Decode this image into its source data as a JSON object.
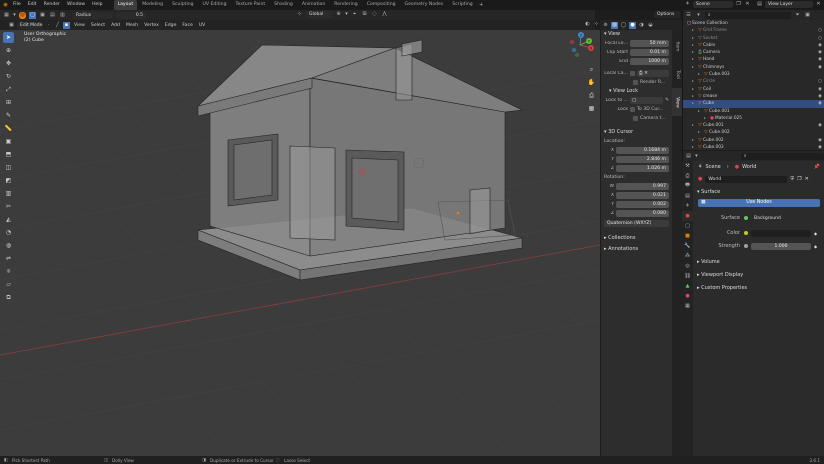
{
  "topbar": {
    "menus": [
      "File",
      "Edit",
      "Render",
      "Window",
      "Help"
    ],
    "workspaces": [
      "Layout",
      "Modeling",
      "Sculpting",
      "UV Editing",
      "Texture Paint",
      "Shading",
      "Animation",
      "Rendering",
      "Compositing",
      "Geometry Nodes",
      "Scripting"
    ],
    "active_workspace": "Layout",
    "radius_label": "Radius",
    "radius_value": "0.5",
    "scene_label": "Scene",
    "view_layer_label": "View Layer"
  },
  "viewport_header": {
    "mode": "Edit Mode",
    "menus": [
      "View",
      "Select",
      "Add",
      "Mesh",
      "Vertex",
      "Edge",
      "Face",
      "UV"
    ],
    "orientation": "Global",
    "options_label": "Options"
  },
  "viewport": {
    "view_name": "User Orthographic",
    "object_name": "(2) Cube"
  },
  "gizmo": {
    "x": "X",
    "y": "Y",
    "z": "Z"
  },
  "npanel": {
    "tabs": [
      "Item",
      "Tool",
      "View"
    ],
    "active_tab": "View",
    "view": {
      "title": "View",
      "focal_label": "Focal Le...",
      "focal_value": "50 mm",
      "clip_start_label": "Clip Start",
      "clip_start_value": "0.01 m",
      "end_label": "End",
      "end_value": "1000 m",
      "local_camera_label": "Local Ca...",
      "render_region_label": "Render R..."
    },
    "view_lock": {
      "title": "View Lock",
      "lock_to_label": "Lock to ...",
      "lock_label": "Lock",
      "to_3d_cursor": "To 3D Cur...",
      "camera_to": "Camera t..."
    },
    "cursor": {
      "title": "3D Cursor",
      "location_label": "Location:",
      "loc_x_label": "X",
      "loc_x": "0.1684 m",
      "loc_y_label": "Y",
      "loc_y": "2.846 m",
      "loc_z_label": "Z",
      "loc_z": "1.026 m",
      "rotation_label": "Rotation:",
      "rot_w_label": "W",
      "rot_w": "0.997",
      "rot_x_label": "X",
      "rot_x": "0.021",
      "rot_y_label": "Y",
      "rot_y": "0.002",
      "rot_z_label": "Z",
      "rot_z": "0.080",
      "rotation_mode": "Quaternion (WXYZ)"
    },
    "collections_title": "Collections",
    "annotations_title": "Annotations"
  },
  "outliner": {
    "root": "Scene Collection",
    "items": [
      {
        "name": "Grid Frame",
        "icon": "mesh",
        "indent": 1,
        "dim": true,
        "vis": "○"
      },
      {
        "name": "Socket",
        "icon": "mesh",
        "indent": 1,
        "dim": true,
        "vis": "○"
      },
      {
        "name": "Cabin",
        "icon": "mesh",
        "indent": 1,
        "dim": false,
        "vis": "◉"
      },
      {
        "name": "Camera",
        "icon": "camera",
        "indent": 1,
        "dim": false,
        "vis": "◉"
      },
      {
        "name": "Hand",
        "icon": "mesh",
        "indent": 1,
        "dim": false,
        "vis": "◉"
      },
      {
        "name": "Chimneys",
        "icon": "mesh",
        "indent": 1,
        "dim": false,
        "vis": "◉"
      },
      {
        "name": "Cube.003",
        "icon": "mesh",
        "indent": 2,
        "dim": false,
        "vis": ""
      },
      {
        "name": "Circle",
        "icon": "mesh",
        "indent": 1,
        "dim": true,
        "vis": "○"
      },
      {
        "name": "Coil",
        "icon": "mesh",
        "indent": 1,
        "dim": false,
        "vis": "◉"
      },
      {
        "name": "crease",
        "icon": "mesh",
        "indent": 1,
        "dim": false,
        "vis": "◉"
      },
      {
        "name": "Cube",
        "icon": "mesh",
        "indent": 1,
        "dim": false,
        "vis": "◉",
        "selected": true
      },
      {
        "name": "Cube.001",
        "icon": "mesh",
        "indent": 2,
        "dim": false,
        "vis": ""
      },
      {
        "name": "Material.025",
        "icon": "material",
        "indent": 3,
        "dim": false,
        "vis": ""
      },
      {
        "name": "Cube.001",
        "icon": "mesh",
        "indent": 1,
        "dim": false,
        "vis": "◉"
      },
      {
        "name": "Cube.002",
        "icon": "mesh",
        "indent": 2,
        "dim": false,
        "vis": ""
      },
      {
        "name": "Cube.002",
        "icon": "mesh",
        "indent": 1,
        "dim": false,
        "vis": "◉"
      },
      {
        "name": "Cube.003",
        "icon": "mesh",
        "indent": 1,
        "dim": false,
        "vis": "◉"
      }
    ]
  },
  "properties": {
    "breadcrumb_scene": "Scene",
    "breadcrumb_world": "World",
    "world_name": "World",
    "surface_title": "Surface",
    "use_nodes_label": "Use Nodes",
    "surface_label": "Surface",
    "surface_value": "Background",
    "color_label": "Color",
    "strength_label": "Strength",
    "strength_value": "1.000",
    "volume_title": "Volume",
    "viewport_display_title": "Viewport Display",
    "custom_properties_title": "Custom Properties",
    "colors": {
      "accent": "#4772b3",
      "color_swatch": "#1f1f1f",
      "socket_yellow": "#c7c729",
      "socket_gray": "#a1a1a1",
      "socket_green": "#63c763"
    }
  },
  "statusbar": {
    "pick_label": "Pick Shortest Path",
    "dolly_label": "Dolly View",
    "extrude_label": "Duplicate or Extrude to Cursor",
    "lasso_label": "Lasso Select",
    "version": "3.6.1"
  }
}
